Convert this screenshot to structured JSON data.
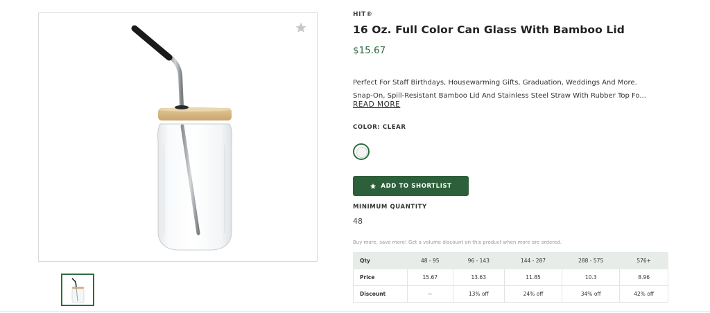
{
  "product": {
    "brand": "HIT®",
    "title": "16 Oz. Full Color Can Glass With Bamboo Lid",
    "price": "$15.67",
    "description_line1": "Perfect For Staff Birthdays, Housewarming Gifts, Graduation, Weddings And More.",
    "description_line2": "Snap-On, Spill-Resistant Bamboo Lid And Stainless Steel Straw With Rubber Top Fo...",
    "read_more": "READ MORE",
    "color_label": "COLOR: CLEAR",
    "add_button_label": "ADD TO SHORTLIST",
    "min_qty_label": "MINIMUM QUANTITY",
    "min_qty_value": "48",
    "volume_note": "Buy more, save more! Get a volume discount on this product when more are ordered."
  },
  "pricing_table": {
    "headers": [
      "Qty",
      "48 - 95",
      "96 - 143",
      "144 - 287",
      "288 - 575",
      "576+"
    ],
    "price_row": [
      "Price",
      "15.67",
      "13.63",
      "11.85",
      "10.3",
      "8.96"
    ],
    "discount_row": [
      "Discount",
      "--",
      "13% off",
      "24% off",
      "34% off",
      "42% off"
    ]
  },
  "icons": {
    "favorite": "star-icon",
    "button": "star-icon"
  },
  "colors": {
    "brand_green": "#2d5f3a",
    "price_green": "#2e6a3e",
    "table_header_bg": "#e8ece9"
  }
}
